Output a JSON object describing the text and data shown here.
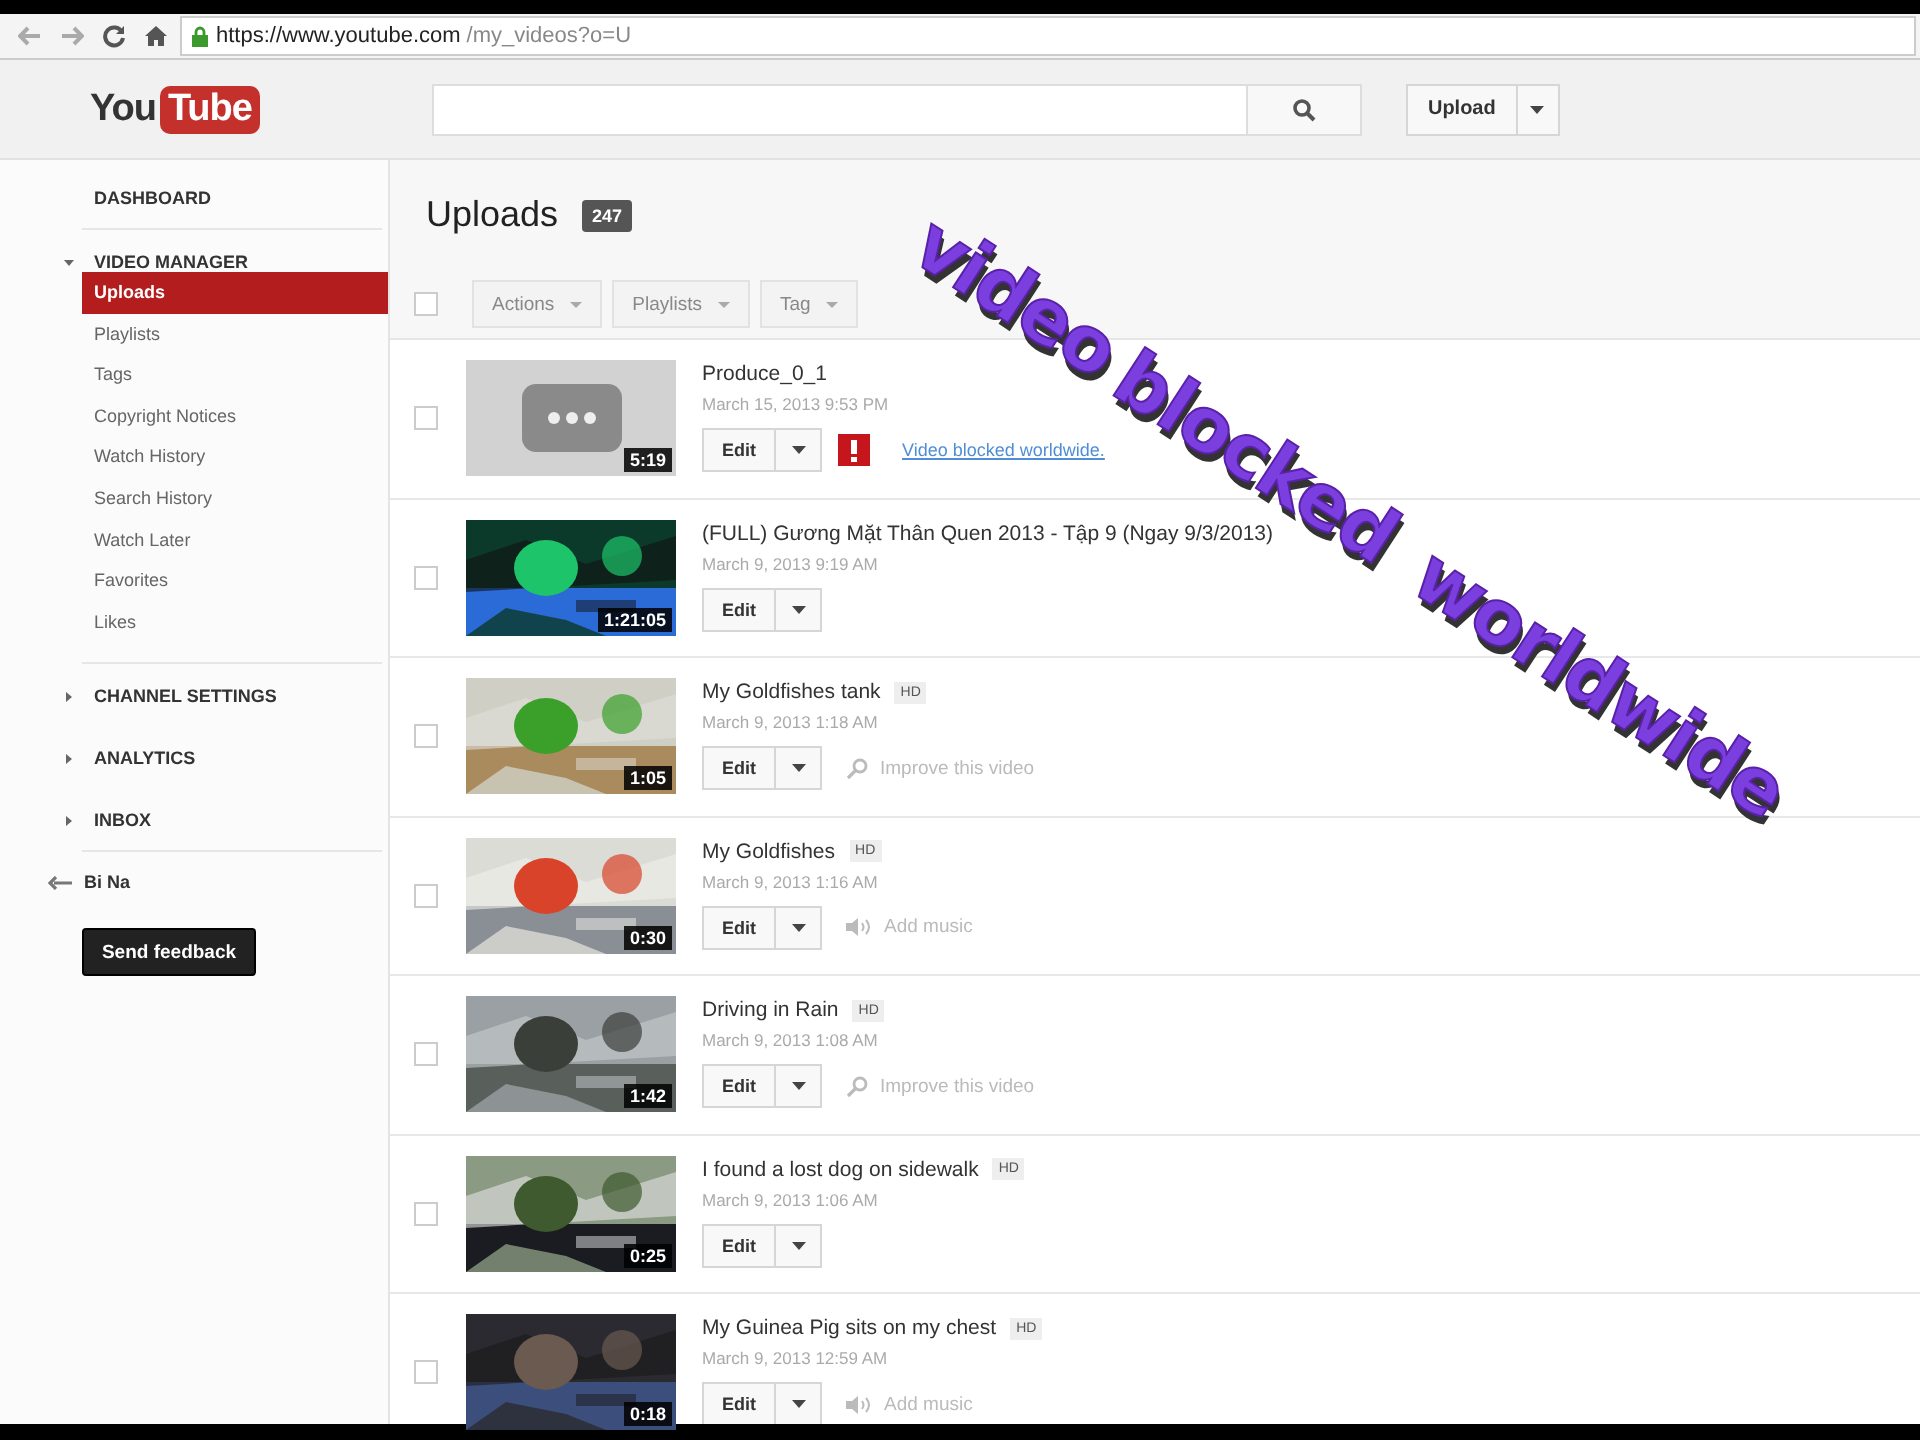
{
  "browser": {
    "url_host": "https://www.youtube.com",
    "url_path": "/my_videos?o=U"
  },
  "header": {
    "logo_you": "You",
    "logo_tube": "Tube",
    "upload_button": "Upload"
  },
  "sidebar": {
    "dashboard": "DASHBOARD",
    "sections": [
      {
        "label": "VIDEO MANAGER",
        "expanded": true,
        "items": [
          {
            "label": "Uploads",
            "selected": true
          },
          {
            "label": "Playlists",
            "selected": false
          },
          {
            "label": "Tags",
            "selected": false
          },
          {
            "label": "Copyright Notices",
            "selected": false
          },
          {
            "label": "Watch History",
            "selected": false
          },
          {
            "label": "Search History",
            "selected": false
          },
          {
            "label": "Watch Later",
            "selected": false
          },
          {
            "label": "Favorites",
            "selected": false
          },
          {
            "label": "Likes",
            "selected": false
          }
        ]
      },
      {
        "label": "CHANNEL SETTINGS",
        "expanded": false
      },
      {
        "label": "ANALYTICS",
        "expanded": false
      },
      {
        "label": "INBOX",
        "expanded": false
      }
    ],
    "user": "Bi Na",
    "feedback_button": "Send feedback"
  },
  "uploads": {
    "title": "Uploads",
    "count": "247",
    "select_all_checked": false,
    "toolbar": [
      "Actions",
      "Playlists",
      "Tag"
    ],
    "videos": [
      {
        "checked": false,
        "title": "Produce_0_1",
        "date": "March 15, 2013 9:53 PM",
        "duration": "5:19",
        "thumb": {
          "kind": "placeholder"
        },
        "edit": "Edit",
        "action": {
          "kind": "blocked",
          "text": "Video blocked worldwide."
        }
      },
      {
        "checked": false,
        "title": "(FULL) Gương Mặt Thân Quen 2013 - Tập 9 (Ngay 9/3/2013)",
        "date": "March 9, 2013 9:19 AM",
        "duration": "1:21:05",
        "edit": "Edit"
      },
      {
        "checked": false,
        "title": "My Goldfishes tank",
        "hd": "HD",
        "date": "March 9, 2013 1:18 AM",
        "duration": "1:05",
        "edit": "Edit",
        "action": {
          "kind": "improve",
          "text": "Improve this video"
        }
      },
      {
        "checked": false,
        "title": "My Goldfishes",
        "hd": "HD",
        "date": "March 9, 2013 1:16 AM",
        "duration": "0:30",
        "edit": "Edit",
        "action": {
          "kind": "music",
          "text": "Add music"
        }
      },
      {
        "checked": false,
        "title": "Driving in Rain",
        "hd": "HD",
        "date": "March 9, 2013 1:08 AM",
        "duration": "1:42",
        "edit": "Edit",
        "action": {
          "kind": "improve",
          "text": "Improve this video"
        }
      },
      {
        "checked": false,
        "title": "I found a lost dog on sidewalk",
        "hd": "HD",
        "date": "March 9, 2013 1:06 AM",
        "duration": "0:25",
        "edit": "Edit"
      },
      {
        "checked": false,
        "title": "My Guinea Pig sits on my chest",
        "hd": "HD",
        "date": "March 9, 2013 12:59 AM",
        "duration": "0:18",
        "edit": "Edit",
        "action": {
          "kind": "music",
          "text": "Add music"
        }
      }
    ]
  },
  "overlay_caption": [
    "video",
    "blocked",
    "worldwide"
  ]
}
